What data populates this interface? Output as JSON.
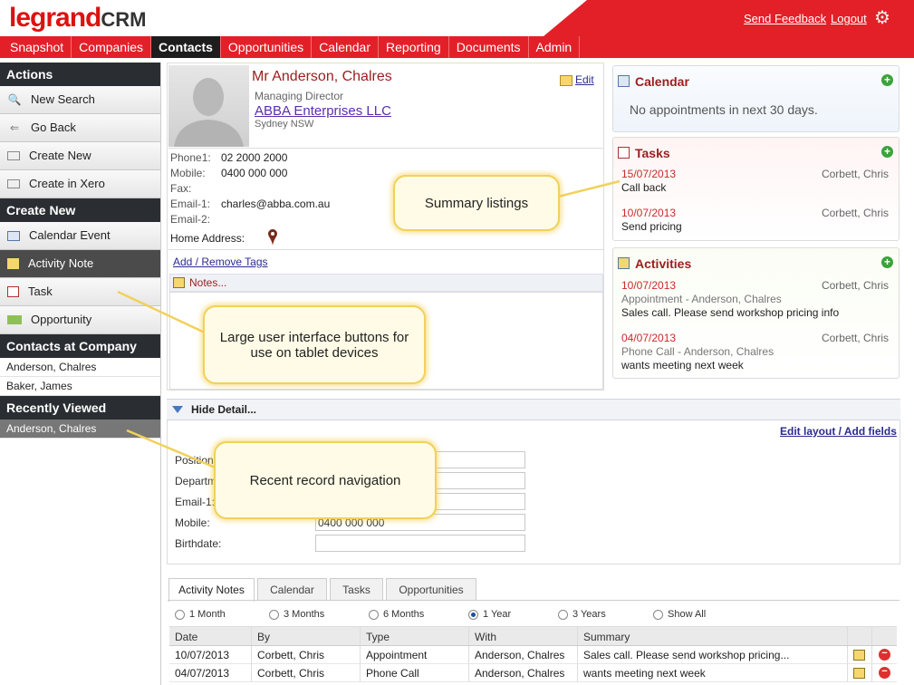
{
  "header": {
    "logo_main": "legrand",
    "logo_suffix": "CRM",
    "send_feedback": "Send Feedback",
    "logout": "Logout",
    "settings_icon": "gear-icon"
  },
  "nav": {
    "tabs": [
      {
        "label": "Snapshot"
      },
      {
        "label": "Companies"
      },
      {
        "label": "Contacts"
      },
      {
        "label": "Opportunities"
      },
      {
        "label": "Calendar"
      },
      {
        "label": "Reporting"
      },
      {
        "label": "Documents"
      },
      {
        "label": "Admin"
      }
    ],
    "active": "Contacts"
  },
  "sidebar": {
    "actions_heading": "Actions",
    "actions": [
      {
        "label": "New Search",
        "icon": "search-icon"
      },
      {
        "label": "Go Back",
        "icon": "back-arrow-icon"
      },
      {
        "label": "Create New",
        "icon": "create-icon"
      },
      {
        "label": "Create in Xero",
        "icon": "xero-icon"
      }
    ],
    "create_heading": "Create New",
    "create": [
      {
        "label": "Calendar Event",
        "icon": "calendar-icon"
      },
      {
        "label": "Activity Note",
        "icon": "note-icon"
      },
      {
        "label": "Task",
        "icon": "task-icon"
      },
      {
        "label": "Opportunity",
        "icon": "money-icon"
      }
    ],
    "contacts_heading": "Contacts at Company",
    "contacts": [
      "Anderson, Chalres",
      "Baker, James"
    ],
    "recent_heading": "Recently Viewed",
    "recent": [
      "Anderson, Chalres"
    ]
  },
  "contact": {
    "name": "Mr Anderson, Chalres",
    "position": "Managing Director",
    "company": "ABBA Enterprises LLC",
    "location": "Sydney NSW",
    "edit_label": "Edit",
    "phone1_label": "Phone1:",
    "phone1": "02 2000 2000",
    "mobile_label": "Mobile:",
    "mobile": "0400 000 000",
    "fax_label": "Fax:",
    "email1_label": "Email-1:",
    "email1": "charles@abba.com.au",
    "email2_label": "Email-2:",
    "home_address_label": "Home Address:",
    "tags_link": "Add / Remove Tags",
    "notes_label": "Notes..."
  },
  "calendar_panel": {
    "title": "Calendar",
    "empty_text": "No appointments in next 30 days."
  },
  "tasks_panel": {
    "title": "Tasks",
    "items": [
      {
        "date": "15/07/2013",
        "who": "Corbett, Chris",
        "text": "Call back"
      },
      {
        "date": "10/07/2013",
        "who": "Corbett, Chris",
        "text": "Send pricing"
      }
    ]
  },
  "activities_panel": {
    "title": "Activities",
    "items": [
      {
        "date": "10/07/2013",
        "who": "Corbett, Chris",
        "subject": "Appointment - Anderson, Chalres",
        "text": "Sales call. Please send workshop pricing info"
      },
      {
        "date": "04/07/2013",
        "who": "Corbett, Chris",
        "subject": "Phone Call - Anderson, Chalres",
        "text": "wants meeting next week"
      }
    ]
  },
  "detail": {
    "toggle_label": "Hide Detail...",
    "layout_link": "Edit layout / Add fields",
    "fields": [
      {
        "label": "Position:",
        "value": ""
      },
      {
        "label": "Department:",
        "value": ""
      },
      {
        "label": "Email-1:",
        "value": ""
      },
      {
        "label": "Mobile:",
        "value": "0400 000 000"
      },
      {
        "label": "Birthdate:",
        "value": ""
      }
    ]
  },
  "bottom_tabs": {
    "tabs": [
      "Activity Notes",
      "Calendar",
      "Tasks",
      "Opportunities"
    ],
    "active": "Activity Notes",
    "ranges": [
      "1 Month",
      "3 Months",
      "6 Months",
      "1 Year",
      "3 Years",
      "Show All"
    ],
    "selected_range": "1 Year",
    "columns": [
      "Date",
      "By",
      "Type",
      "With",
      "Summary"
    ],
    "rows": [
      {
        "date": "10/07/2013",
        "by": "Corbett, Chris",
        "type": "Appointment",
        "with": "Anderson, Chalres",
        "summary": "Sales call. Please send workshop pricing..."
      },
      {
        "date": "04/07/2013",
        "by": "Corbett, Chris",
        "type": "Phone Call",
        "with": "Anderson, Chalres",
        "summary": "wants meeting next week"
      }
    ]
  },
  "callouts": {
    "summary": "Summary listings",
    "large_buttons": "Large user interface buttons for use on tablet devices",
    "recent_nav": "Recent record navigation"
  },
  "colors": {
    "brand_red": "#e32028",
    "heading_dark": "#2a2e33",
    "date_red": "#cc2a2a",
    "callout_border": "#f1d15a"
  }
}
